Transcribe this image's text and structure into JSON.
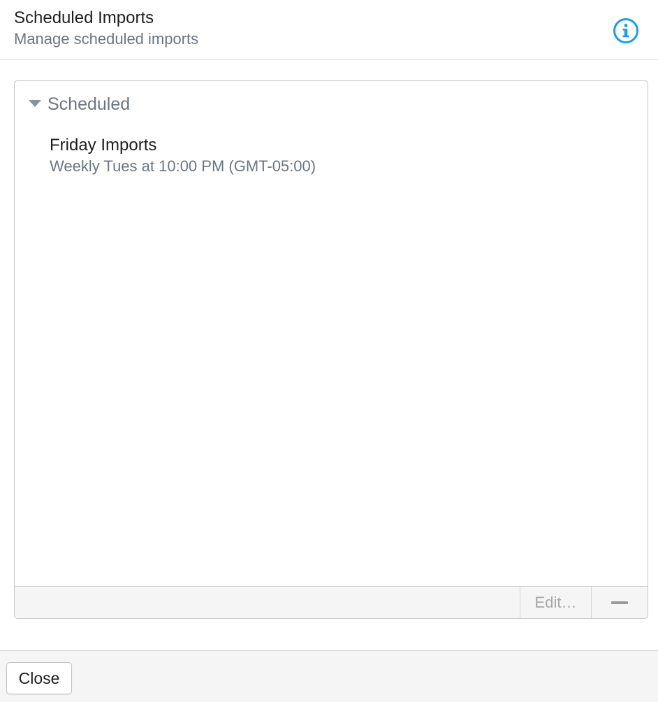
{
  "header": {
    "title": "Scheduled Imports",
    "subtitle": "Manage scheduled imports",
    "info_icon": "info-icon",
    "accent_color": "#1a9df0"
  },
  "section": {
    "label": "Scheduled",
    "expanded": true,
    "items": [
      {
        "title": "Friday Imports",
        "schedule": "Weekly Tues at 10:00 PM (GMT-05:00)"
      }
    ]
  },
  "panel_footer": {
    "edit_label": "Edit…",
    "remove_icon": "minus-icon"
  },
  "footer": {
    "close_label": "Close"
  }
}
